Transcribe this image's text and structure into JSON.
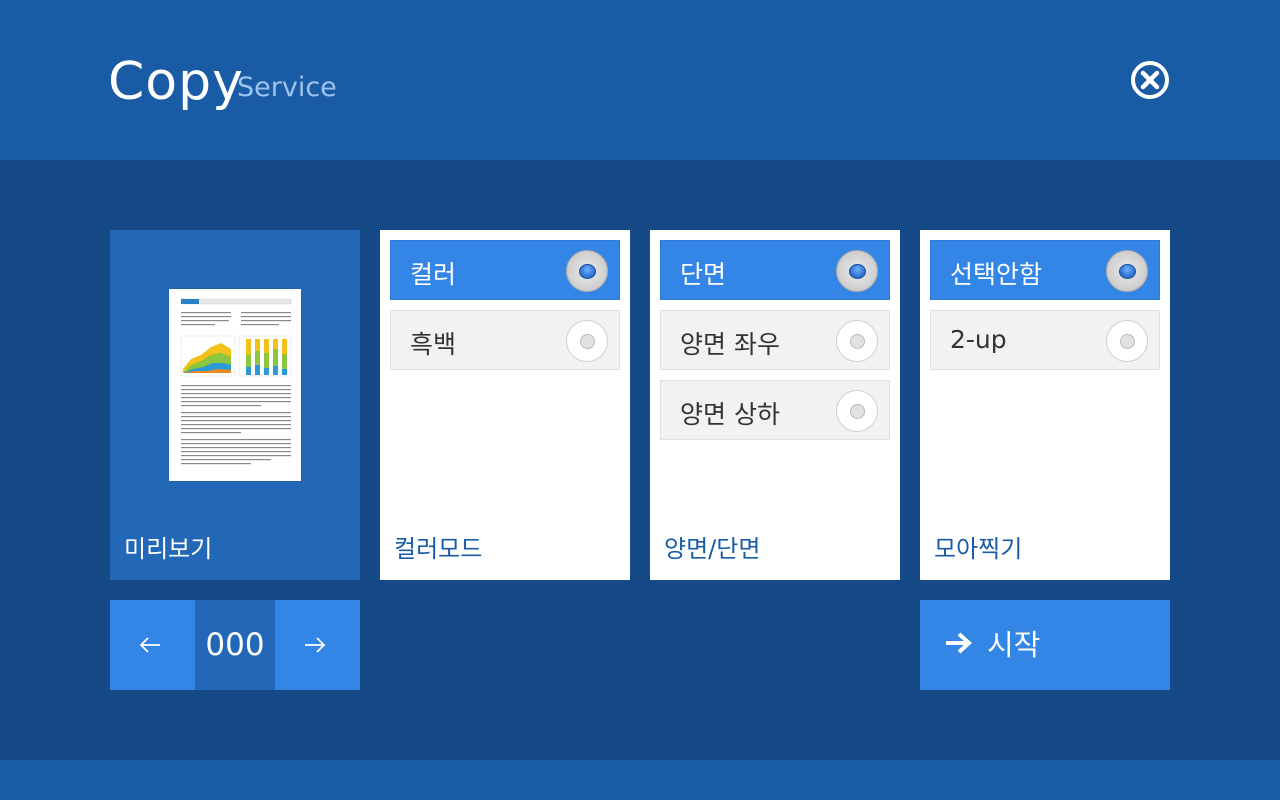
{
  "header": {
    "title": "Copy",
    "subtitle": "Service",
    "close_icon": "close-circle-icon"
  },
  "preview": {
    "label": "미리보기"
  },
  "color_mode": {
    "label": "컬러모드",
    "options": [
      {
        "label": "컬러",
        "selected": true
      },
      {
        "label": "흑백",
        "selected": false
      }
    ]
  },
  "duplex": {
    "label": "양면/단면",
    "options": [
      {
        "label": "단면",
        "selected": true
      },
      {
        "label": "양면 좌우",
        "selected": false
      },
      {
        "label": "양면 상하",
        "selected": false
      }
    ]
  },
  "nup": {
    "label": "모아찍기",
    "options": [
      {
        "label": "선택안함",
        "selected": true
      },
      {
        "label": "2-up",
        "selected": false
      }
    ]
  },
  "pager": {
    "prev_icon": "arrow-left-icon",
    "page": "000",
    "next_icon": "arrow-right-icon"
  },
  "start": {
    "label": "시작",
    "icon": "arrow-right-icon"
  },
  "colors": {
    "header_bg": "#1a5ba6",
    "page_bg": "#154a87",
    "accent": "#3385e6",
    "tile_bg": "#ffffff"
  }
}
